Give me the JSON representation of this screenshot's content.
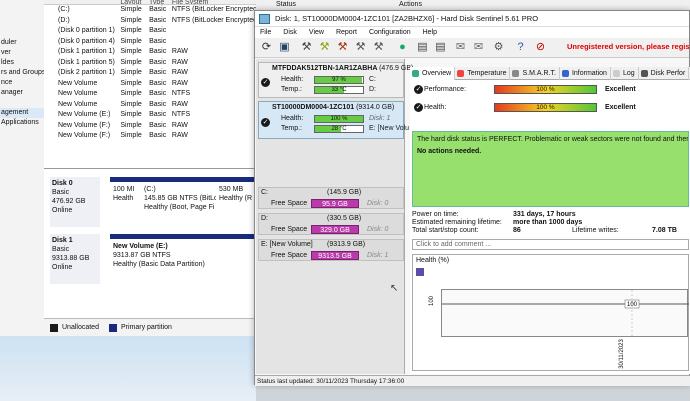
{
  "diskmgmt": {
    "sidebar_items": [
      "duler",
      "ver",
      "ldes",
      "rs and Groups",
      "nce",
      "anager",
      "",
      "",
      "agement",
      "Applications"
    ],
    "columns": {
      "layout": "Layout",
      "type": "Type",
      "fs": "File System",
      "status": "Status",
      "actions": "Actions"
    },
    "volumes": [
      {
        "name": "(C:)",
        "layout": "Simple",
        "type": "Basic",
        "fs": "NTFS (BitLocker Encrypted)"
      },
      {
        "name": "(D:)",
        "layout": "Simple",
        "type": "Basic",
        "fs": "NTFS (BitLocker Encrypted)"
      },
      {
        "name": "(Disk 0 partition 1)",
        "layout": "Simple",
        "type": "Basic",
        "fs": ""
      },
      {
        "name": "(Disk 0 partition 4)",
        "layout": "Simple",
        "type": "Basic",
        "fs": ""
      },
      {
        "name": "(Disk 1 partition 1)",
        "layout": "Simple",
        "type": "Basic",
        "fs": "RAW"
      },
      {
        "name": "(Disk 1 partition 5)",
        "layout": "Simple",
        "type": "Basic",
        "fs": "RAW"
      },
      {
        "name": "(Disk 2 partition 1)",
        "layout": "Simple",
        "type": "Basic",
        "fs": "RAW"
      },
      {
        "name": "New Volume",
        "layout": "Simple",
        "type": "Basic",
        "fs": "RAW"
      },
      {
        "name": "New Volume",
        "layout": "Simple",
        "type": "Basic",
        "fs": "NTFS"
      },
      {
        "name": "New Volume",
        "layout": "Simple",
        "type": "Basic",
        "fs": "RAW"
      },
      {
        "name": "New Volume (E:)",
        "layout": "Simple",
        "type": "Basic",
        "fs": "NTFS"
      },
      {
        "name": "New Volume (F:)",
        "layout": "Simple",
        "type": "Basic",
        "fs": "RAW"
      },
      {
        "name": "New Volume (F:)",
        "layout": "Simple",
        "type": "Basic",
        "fs": "RAW"
      }
    ],
    "disk0": {
      "title": "Disk 0",
      "type": "Basic",
      "size": "476.92 GB",
      "state": "Online",
      "p1_size": "100 MI",
      "p1_state": "Health",
      "p2_name": "(C:)",
      "p2_size": "145.85 GB NTFS (BitLoc",
      "p2_state": "Healthy (Boot, Page Fi",
      "p3_size": "530 MB",
      "p3_state": "Healthy (R"
    },
    "disk1": {
      "title": "Disk 1",
      "type": "Basic",
      "size": "9313.88 GB",
      "state": "Online",
      "p_name": "New Volume (E:)",
      "p_size": "9313.87 GB NTFS",
      "p_state": "Healthy (Basic Data Partition)"
    },
    "legend": {
      "unallocated": "Unallocated",
      "primary": "Primary partition"
    },
    "colors": {
      "unallocated": "#1a1a1a",
      "primary": "#1a2a7c"
    }
  },
  "hds": {
    "title": "Disk: 1, ST10000DM0004-1ZC101 [ZA2BHZX6]  -  Hard Disk Sentinel 5.61 PRO",
    "menu": [
      "File",
      "Disk",
      "View",
      "Report",
      "Configuration",
      "Help"
    ],
    "unregistered": "Unregistered version, please registe",
    "disks": [
      {
        "name": "MTFDDAK512TBN-1AR1ZABHA",
        "size": "(476.9 GB)",
        "health": "97 %",
        "health_pct": 97,
        "temp": "33 °C",
        "drives": [
          "C:",
          "D:"
        ]
      },
      {
        "name": "ST10000DM0004-1ZC101",
        "size": "(9314.0 GB)",
        "health": "100 %",
        "health_pct": 100,
        "temp": "28 °C",
        "drives": [
          "Disk: 1",
          "E: [New Volu"
        ]
      }
    ],
    "labels": {
      "health": "Health:",
      "temp": "Temp.:",
      "free_space": "Free Space"
    },
    "volumes": [
      {
        "name": "C:",
        "size": "(145.9 GB)",
        "free": "95.9 GB",
        "disk": "Disk: 0"
      },
      {
        "name": "D:",
        "size": "(330.5 GB)",
        "free": "329.0 GB",
        "disk": "Disk: 0"
      },
      {
        "name": "E: [New Volume]",
        "size": "(9313.9 GB)",
        "free": "9313.5 GB",
        "disk": "Disk: 1"
      }
    ],
    "tabs": [
      "Overview",
      "Temperature",
      "S.M.A.R.T.",
      "Information",
      "Log",
      "Disk Perfor"
    ],
    "performance": {
      "label": "Performance:",
      "value": "100 %",
      "pct": 100,
      "result": "Excellent"
    },
    "health": {
      "label": "Health:",
      "value": "100 %",
      "pct": 100,
      "result": "Excellent"
    },
    "status_text": "The hard disk status is PERFECT. Problematic or weak sectors were not found and there are",
    "actions_text": "No actions needed.",
    "power_on_label": "Power on time:",
    "power_on_value": "331 days, 17 hours",
    "remaining_label": "Estimated remaining lifetime:",
    "remaining_value": "more than 1000 days",
    "startstop_label": "Total start/stop count:",
    "startstop_value": "86",
    "writes_label": "Lifetime writes:",
    "writes_value": "7.08 TB",
    "comment_placeholder": "Click to add comment ...",
    "health_chart_title": "Health (%)",
    "chart_ytick": "100",
    "chart_point_label": "100",
    "chart_xtick": "30/11/2023",
    "status_bar": "Status last updated: 30/11/2023 Thursday 17:36:00"
  }
}
